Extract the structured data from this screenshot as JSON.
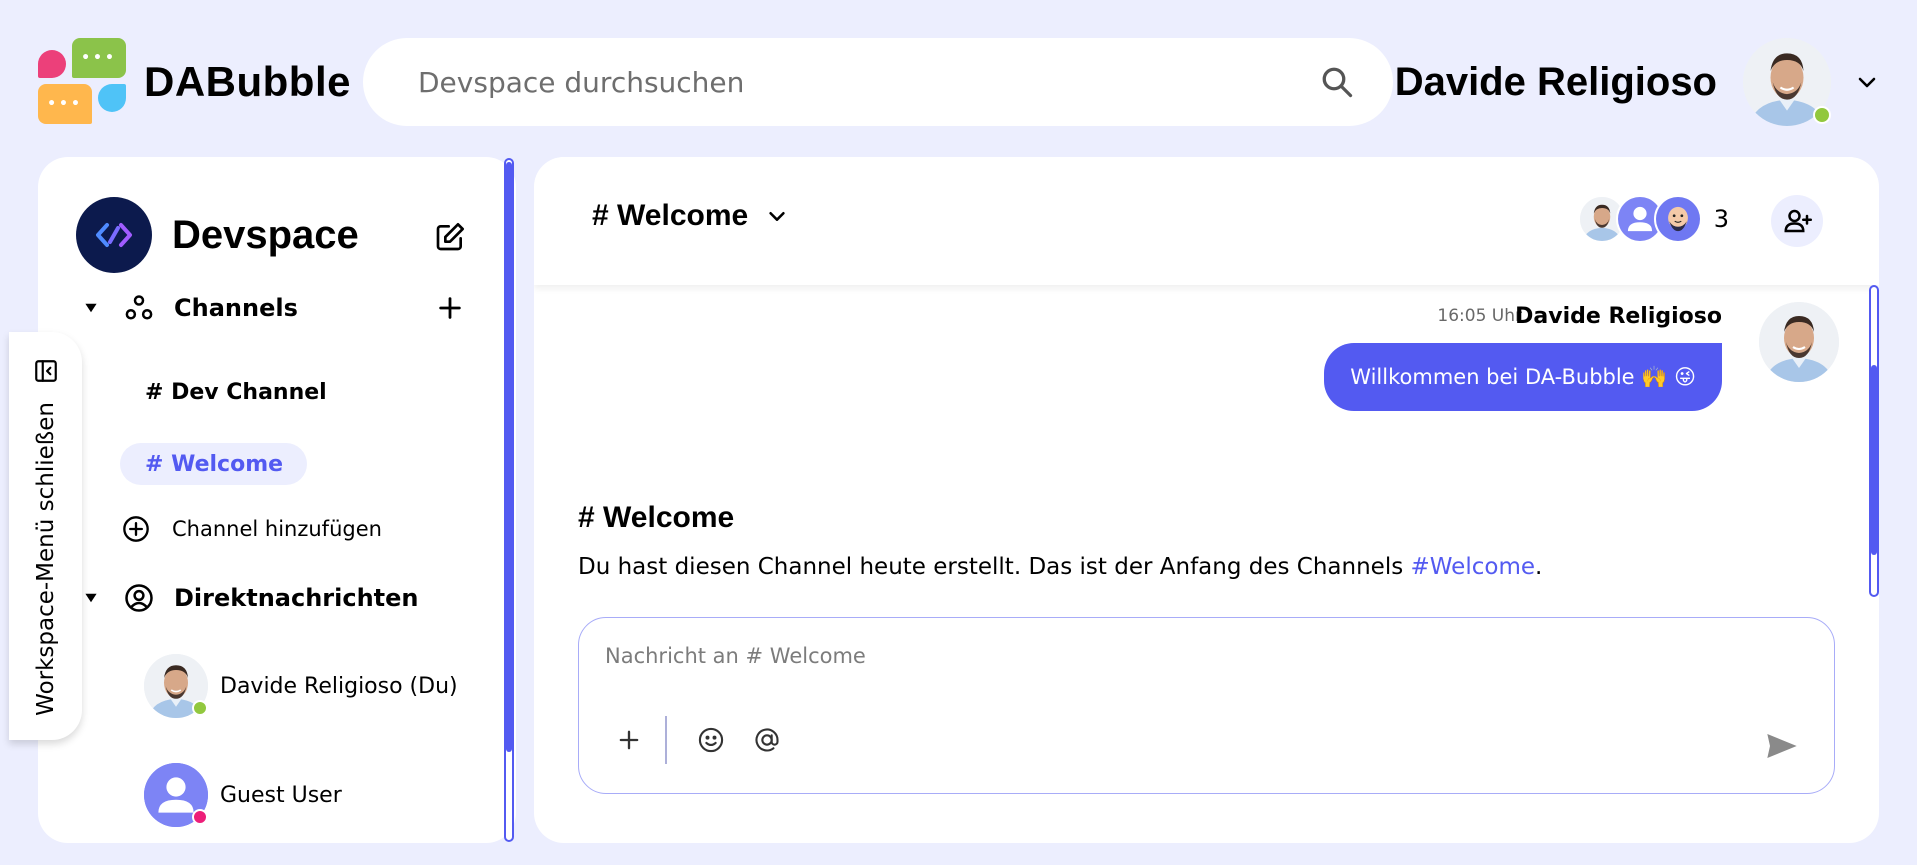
{
  "app": {
    "name": "DABubble"
  },
  "search": {
    "placeholder": "Devspace durchsuchen"
  },
  "user": {
    "name": "Davide Religioso",
    "status": "online"
  },
  "workspace": {
    "title": "Devspace",
    "toggle_label": "Workspace-Menü schließen"
  },
  "sidebar": {
    "channels_label": "Channels",
    "channels": [
      {
        "label": "# Dev Channel",
        "active": false
      },
      {
        "label": "# Welcome",
        "active": true
      }
    ],
    "add_channel_label": "Channel hinzufügen",
    "dm_label": "Direktnachrichten",
    "dms": [
      {
        "name": "Davide Religioso (Du)",
        "status": "online"
      },
      {
        "name": "Guest User",
        "status": "away"
      }
    ]
  },
  "channel": {
    "title": "# Welcome",
    "member_count": "3"
  },
  "messages": [
    {
      "time": "16:05 Uhr",
      "author": "Davide Religioso",
      "text": "Willkommen bei DA-Bubble 🙌 😜"
    }
  ],
  "intro": {
    "title": "# Welcome",
    "text": "Du hast diesen Channel heute erstellt. Das ist der Anfang des Channels ",
    "link": "#Welcome",
    "suffix": "."
  },
  "composer": {
    "placeholder": "Nachricht an # Welcome"
  },
  "colors": {
    "accent": "#535af1",
    "background": "#eceefe",
    "online": "#92c83e",
    "away": "#ed1e79"
  }
}
